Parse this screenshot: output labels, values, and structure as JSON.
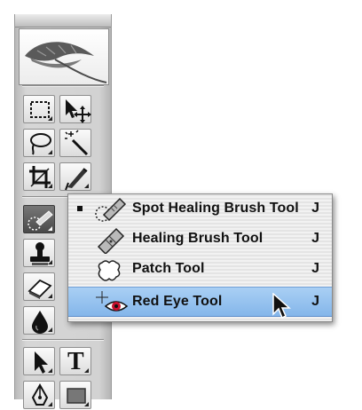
{
  "toolbox": {
    "tools": [
      {
        "icon": "marquee-tool-icon"
      },
      {
        "icon": "move-tool-icon"
      },
      {
        "icon": "lasso-tool-icon"
      },
      {
        "icon": "magic-wand-tool-icon"
      },
      {
        "icon": "crop-tool-icon"
      },
      {
        "icon": "slice-tool-icon"
      },
      {
        "icon": "spot-healing-brush-tool-icon",
        "active": true
      },
      {
        "icon": "stamp-tool-icon"
      },
      {
        "icon": "eraser-tool-icon"
      },
      {
        "icon": "blur-tool-icon"
      },
      {
        "icon": "path-selection-tool-icon"
      },
      {
        "icon": "type-tool-icon",
        "glyph": "T"
      },
      {
        "icon": "pen-tool-icon"
      },
      {
        "icon": "shape-tool-icon"
      }
    ]
  },
  "flyout": {
    "items": [
      {
        "label": "Spot Healing Brush Tool",
        "shortcut": "J",
        "icon": "spot-healing-brush-icon",
        "selected": true
      },
      {
        "label": "Healing Brush Tool",
        "shortcut": "J",
        "icon": "healing-brush-icon"
      },
      {
        "label": "Patch Tool",
        "shortcut": "J",
        "icon": "patch-tool-icon"
      },
      {
        "label": "Red Eye Tool",
        "shortcut": "J",
        "icon": "red-eye-tool-icon",
        "highlighted": true
      }
    ]
  },
  "colors": {
    "highlight": "#8dbcec",
    "red_eye": "#c8102e"
  }
}
